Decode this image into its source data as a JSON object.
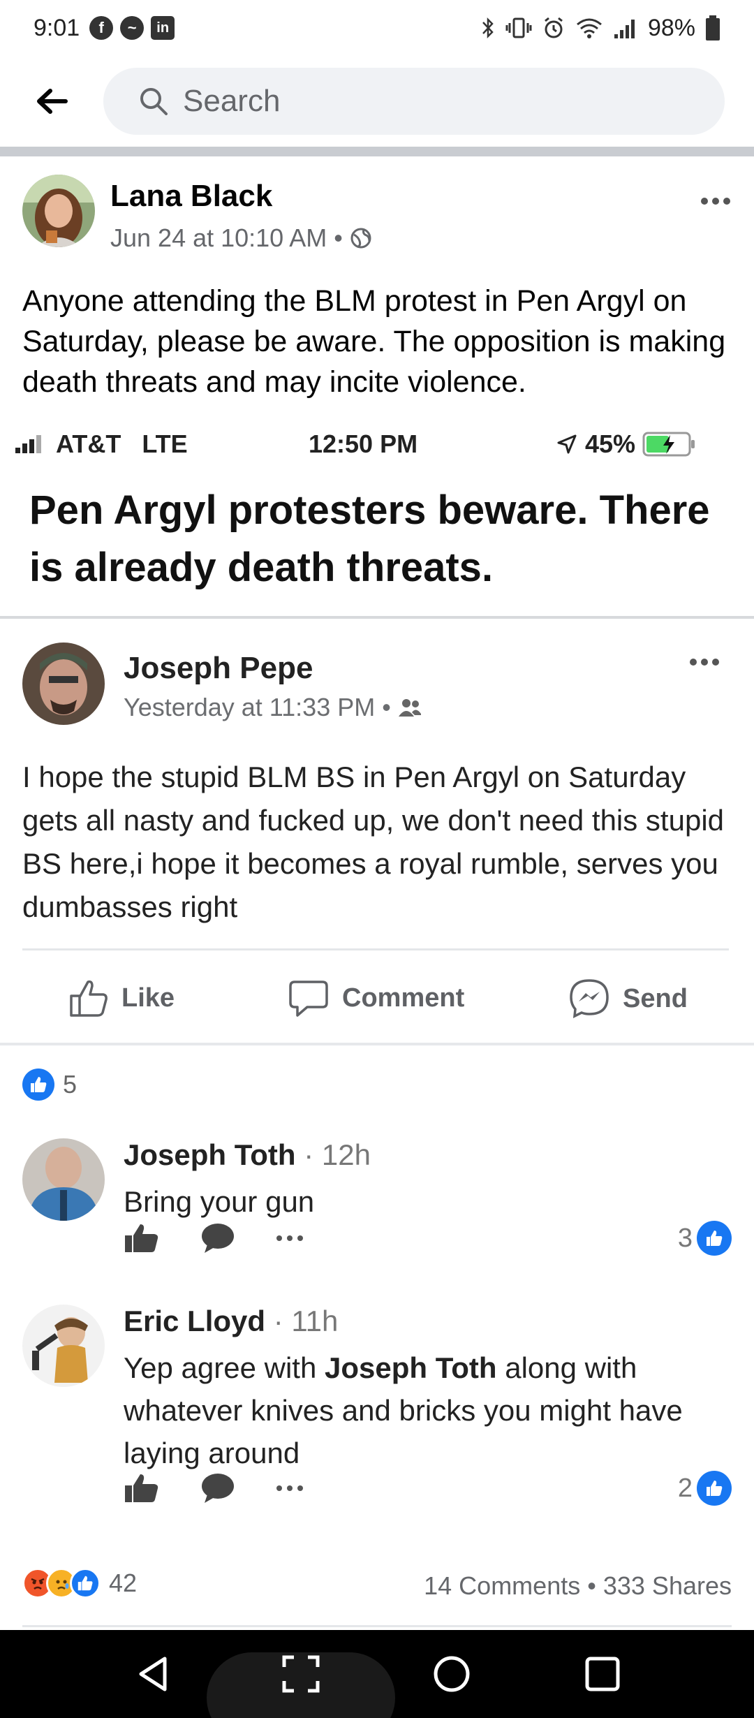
{
  "status_bar": {
    "time": "9:01",
    "battery": "98%",
    "notification_icons": [
      "facebook-icon",
      "messenger-icon",
      "linkedin-icon"
    ],
    "system_icons": [
      "bluetooth-icon",
      "vibrate-icon",
      "alarm-icon",
      "wifi-icon",
      "signal-icon",
      "battery-icon"
    ]
  },
  "header": {
    "search_placeholder": "Search"
  },
  "post": {
    "author": "Lana Black",
    "timestamp": "Jun 24 at 10:10 AM",
    "separator": "•",
    "privacy": "public",
    "text": "Anyone attending the BLM protest in Pen Argyl on Saturday, please be aware. The opposition is making death threats and may incite violence.",
    "reaction_count": "42",
    "comments": "14 Comments",
    "stats_separator": "•",
    "shares": "333 Shares"
  },
  "embed": {
    "status": {
      "carrier": "AT&T",
      "network": "LTE",
      "time": "12:50 PM",
      "battery": "45%"
    },
    "title": "Pen Argyl protesters beware. There is already death threats.",
    "inner_post": {
      "author": "Joseph Pepe",
      "timestamp": "Yesterday at 11:33 PM",
      "separator": "•",
      "text": "I hope the stupid BLM BS in Pen Argyl on Saturday gets all nasty and fucked up, we don't need this stupid BS here,i hope it becomes a royal rumble, serves you dumbasses right",
      "actions": {
        "like": "Like",
        "comment": "Comment",
        "send": "Send"
      },
      "like_count": "5"
    },
    "comments": [
      {
        "name": "Joseph Toth",
        "time": "12h",
        "text": "Bring your gun",
        "likes": "3"
      },
      {
        "name": "Eric Lloyd",
        "time": "11h",
        "text_before": "Yep agree with ",
        "mention": "Joseph Toth",
        "text_after": " along with whatever knives and bricks you might have laying around",
        "likes": "2"
      }
    ]
  },
  "colors": {
    "facebook_blue": "#1877f2",
    "meta_gray": "#65676b",
    "search_bg": "#f0f2f5",
    "angry_react": "#f0552a",
    "sad_react": "#f7b125"
  }
}
